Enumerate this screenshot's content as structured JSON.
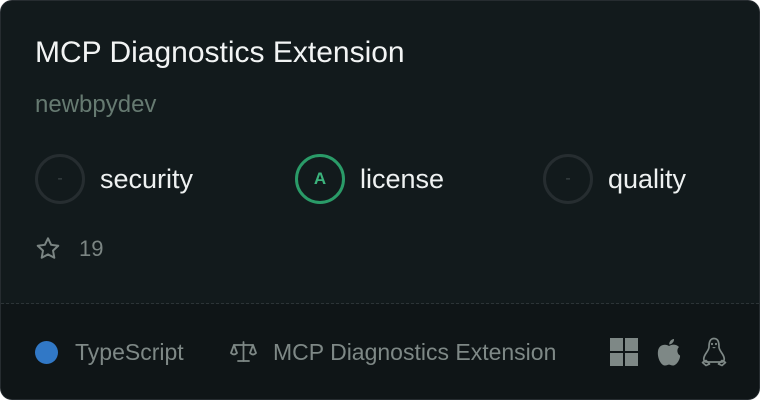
{
  "card": {
    "title": "MCP Diagnostics Extension",
    "author": "newbpydev",
    "scores": [
      {
        "grade": "-",
        "label": "security"
      },
      {
        "grade": "A",
        "label": "license"
      },
      {
        "grade": "-",
        "label": "quality"
      }
    ],
    "stars": {
      "icon": "star-icon",
      "count": "19"
    },
    "footer": {
      "language": {
        "label": "TypeScript",
        "color": "#3178c6"
      },
      "license": {
        "icon": "scale-icon",
        "label": "MCP Diagnostics Extension"
      },
      "platforms": [
        "windows-icon",
        "apple-icon",
        "linux-icon"
      ]
    }
  },
  "colors": {
    "card_bg": "#121a1c",
    "footer_bg": "#0f1517",
    "grade_a": "#2a9b68",
    "author": "#667a71"
  }
}
